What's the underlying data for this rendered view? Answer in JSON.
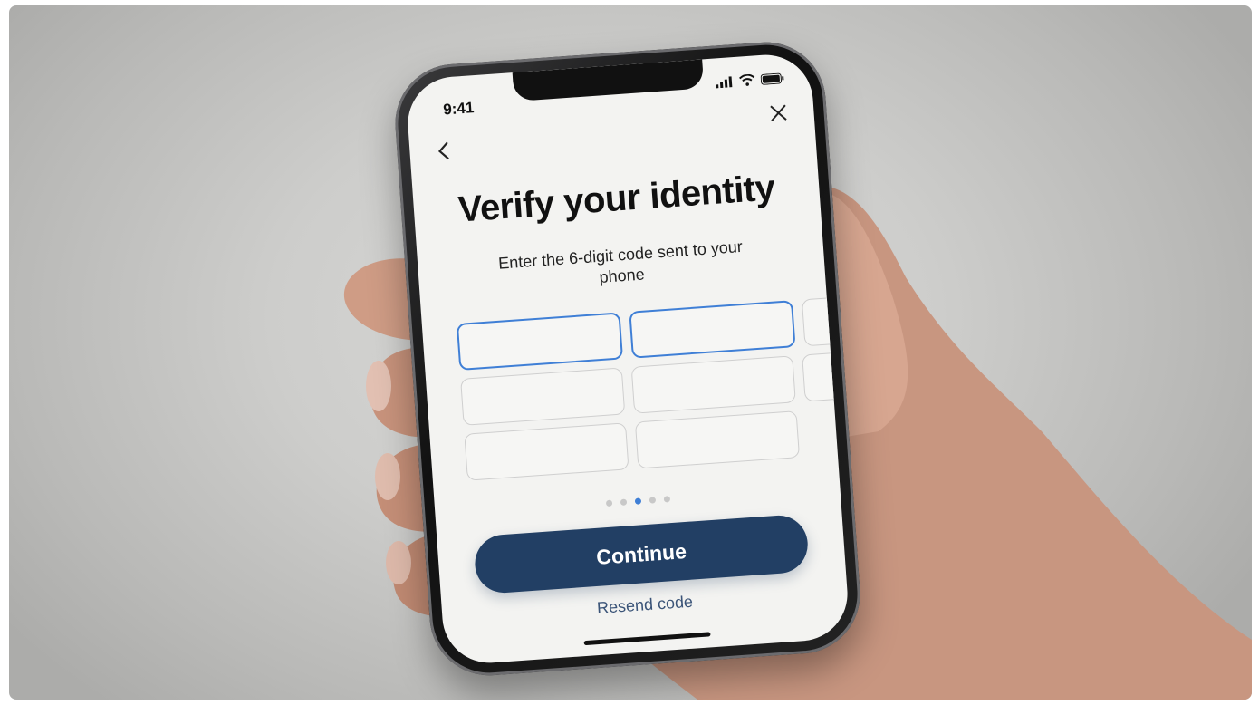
{
  "status_bar": {
    "time": "9:41"
  },
  "nav": {
    "back_icon": "chevron-left-icon",
    "close_icon": "close-icon"
  },
  "screen": {
    "title": "Verify your identity",
    "subtitle": "Enter the 6-digit code sent to your phone",
    "code_rows": [
      {
        "cells": [
          {
            "value": "",
            "active": true
          },
          {
            "value": "",
            "active": true
          },
          {
            "value": "",
            "active": false
          },
          {
            "value": "",
            "active": true
          }
        ]
      },
      {
        "cells": [
          {
            "value": "",
            "active": false
          },
          {
            "value": "",
            "active": false
          },
          {
            "value": "",
            "active": false
          },
          {
            "value": "",
            "active": false
          }
        ]
      },
      {
        "cells": [
          {
            "value": "",
            "active": false
          },
          {
            "value": "",
            "active": false
          }
        ]
      }
    ],
    "page_dots": {
      "total": 5,
      "active_index": 2
    },
    "continue_label": "Continue",
    "resend_label": "Resend code"
  },
  "colors": {
    "accent": "#3f7fd6",
    "button": "#223f64",
    "link": "#3b5478"
  }
}
